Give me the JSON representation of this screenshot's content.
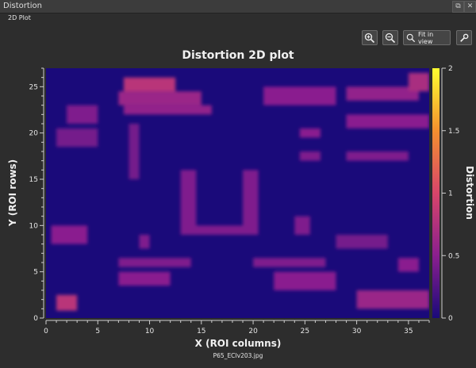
{
  "window": {
    "title": "Distortion",
    "tab": "2D Plot"
  },
  "toolbar": {
    "zoom_in_icon": "zoom-in-icon",
    "zoom_out_icon": "zoom-out-icon",
    "fit_label": "Fit in view",
    "settings_icon": "wrench-icon"
  },
  "colors": {
    "background": "#2d2d2d",
    "plot_background": "#1a0a7a",
    "colormap": [
      "#1a0a7a",
      "#8a1f8f",
      "#d8456a",
      "#f4902e",
      "#ffff30"
    ]
  },
  "chart_data": {
    "type": "heatmap",
    "title": "Distortion 2D plot",
    "xlabel": "X (ROI columns)",
    "ylabel": "Y (ROI rows)",
    "colorbar_label": "Distortion",
    "xlim": [
      0,
      37
    ],
    "ylim": [
      0,
      27
    ],
    "color_range": [
      0,
      2
    ],
    "xticks": [
      0,
      5,
      10,
      15,
      20,
      25,
      30,
      35
    ],
    "yticks": [
      0,
      5,
      10,
      15,
      20,
      25
    ],
    "colorbar_ticks": [
      0,
      0.5,
      1,
      1.5,
      2
    ],
    "colorbar_tick_labels": [
      "0",
      "0.5",
      "1",
      "1.5",
      "2"
    ],
    "features": [
      {
        "x0": 7.5,
        "x1": 12.5,
        "y0": 24.5,
        "y1": 26,
        "v": 0.8
      },
      {
        "x0": 7,
        "x1": 15,
        "y0": 23,
        "y1": 24.5,
        "v": 0.6
      },
      {
        "x0": 7.5,
        "x1": 16,
        "y0": 22,
        "y1": 23,
        "v": 0.55
      },
      {
        "x0": 21,
        "x1": 28,
        "y0": 23,
        "y1": 25,
        "v": 0.5
      },
      {
        "x0": 29,
        "x1": 36,
        "y0": 23.5,
        "y1": 25,
        "v": 0.55
      },
      {
        "x0": 35,
        "x1": 37,
        "y0": 24.5,
        "y1": 26.5,
        "v": 0.7
      },
      {
        "x0": 2,
        "x1": 5,
        "y0": 21,
        "y1": 23,
        "v": 0.45
      },
      {
        "x0": 1,
        "x1": 5,
        "y0": 18.5,
        "y1": 20.5,
        "v": 0.4
      },
      {
        "x0": 29,
        "x1": 37,
        "y0": 20.5,
        "y1": 22,
        "v": 0.5
      },
      {
        "x0": 29,
        "x1": 35,
        "y0": 17,
        "y1": 18,
        "v": 0.45
      },
      {
        "x0": 24.5,
        "x1": 26.5,
        "y0": 19.5,
        "y1": 20.5,
        "v": 0.5
      },
      {
        "x0": 24.5,
        "x1": 26.5,
        "y0": 17,
        "y1": 18,
        "v": 0.45
      },
      {
        "x0": 8,
        "x1": 9,
        "y0": 15,
        "y1": 21,
        "v": 0.4
      },
      {
        "x0": 13,
        "x1": 14.5,
        "y0": 9,
        "y1": 16,
        "v": 0.45
      },
      {
        "x0": 14,
        "x1": 20,
        "y0": 9,
        "y1": 10,
        "v": 0.45
      },
      {
        "x0": 19,
        "x1": 20.5,
        "y0": 9,
        "y1": 16,
        "v": 0.45
      },
      {
        "x0": 24,
        "x1": 25.5,
        "y0": 9,
        "y1": 11,
        "v": 0.45
      },
      {
        "x0": 0.5,
        "x1": 4,
        "y0": 8,
        "y1": 10,
        "v": 0.5
      },
      {
        "x0": 9,
        "x1": 10,
        "y0": 7.5,
        "y1": 9,
        "v": 0.45
      },
      {
        "x0": 28,
        "x1": 33,
        "y0": 7.5,
        "y1": 9,
        "v": 0.4
      },
      {
        "x0": 7,
        "x1": 14,
        "y0": 5.5,
        "y1": 6.5,
        "v": 0.45
      },
      {
        "x0": 20,
        "x1": 27,
        "y0": 5.5,
        "y1": 6.5,
        "v": 0.45
      },
      {
        "x0": 7,
        "x1": 12,
        "y0": 3.5,
        "y1": 5,
        "v": 0.5
      },
      {
        "x0": 22,
        "x1": 28,
        "y0": 3,
        "y1": 5,
        "v": 0.5
      },
      {
        "x0": 34,
        "x1": 36,
        "y0": 5,
        "y1": 6.5,
        "v": 0.5
      },
      {
        "x0": 30,
        "x1": 37,
        "y0": 1,
        "y1": 3,
        "v": 0.6
      },
      {
        "x0": 1,
        "x1": 3,
        "y0": 0.8,
        "y1": 2.5,
        "v": 0.8
      }
    ],
    "source_file": "P65_ECIv203.jpg"
  }
}
